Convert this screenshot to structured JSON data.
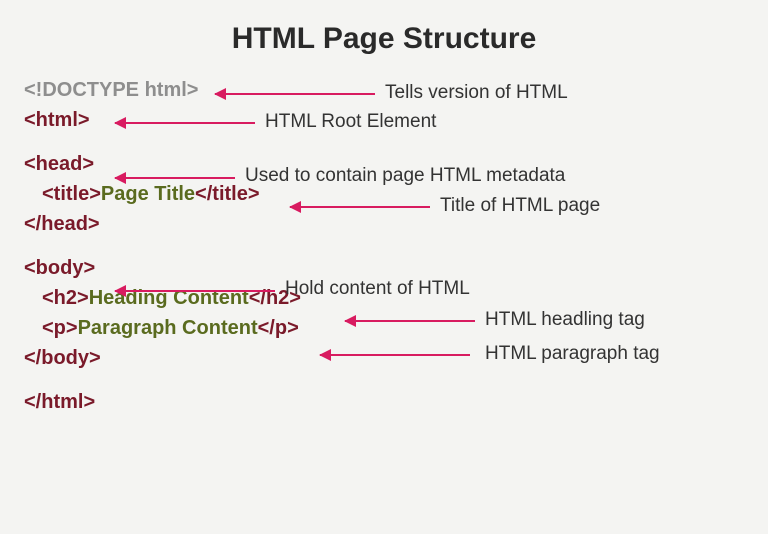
{
  "title": "HTML Page Structure",
  "code": {
    "doctype": "<!DOCTYPE html>",
    "html_open": "<html>",
    "head_open": "<head>",
    "title_open": "<title>",
    "title_text": "Page Title",
    "title_close": "</title>",
    "head_close": "</head>",
    "body_open": "<body>",
    "h2_open": "<h2>",
    "h2_text": "Heading Content",
    "h2_close": "</h2>",
    "p_open": "<p>",
    "p_text": "Paragraph Content",
    "p_close": "</p>",
    "body_close": "</body>",
    "html_close": "</html>"
  },
  "annotations": {
    "doctype": "Tells version of HTML",
    "html": "HTML Root Element",
    "head": "Used to contain  page HTML metadata",
    "title": "Title of HTML page",
    "body": "Hold content of HTML",
    "h2": "HTML headling tag",
    "p": "HTML paragraph tag"
  }
}
